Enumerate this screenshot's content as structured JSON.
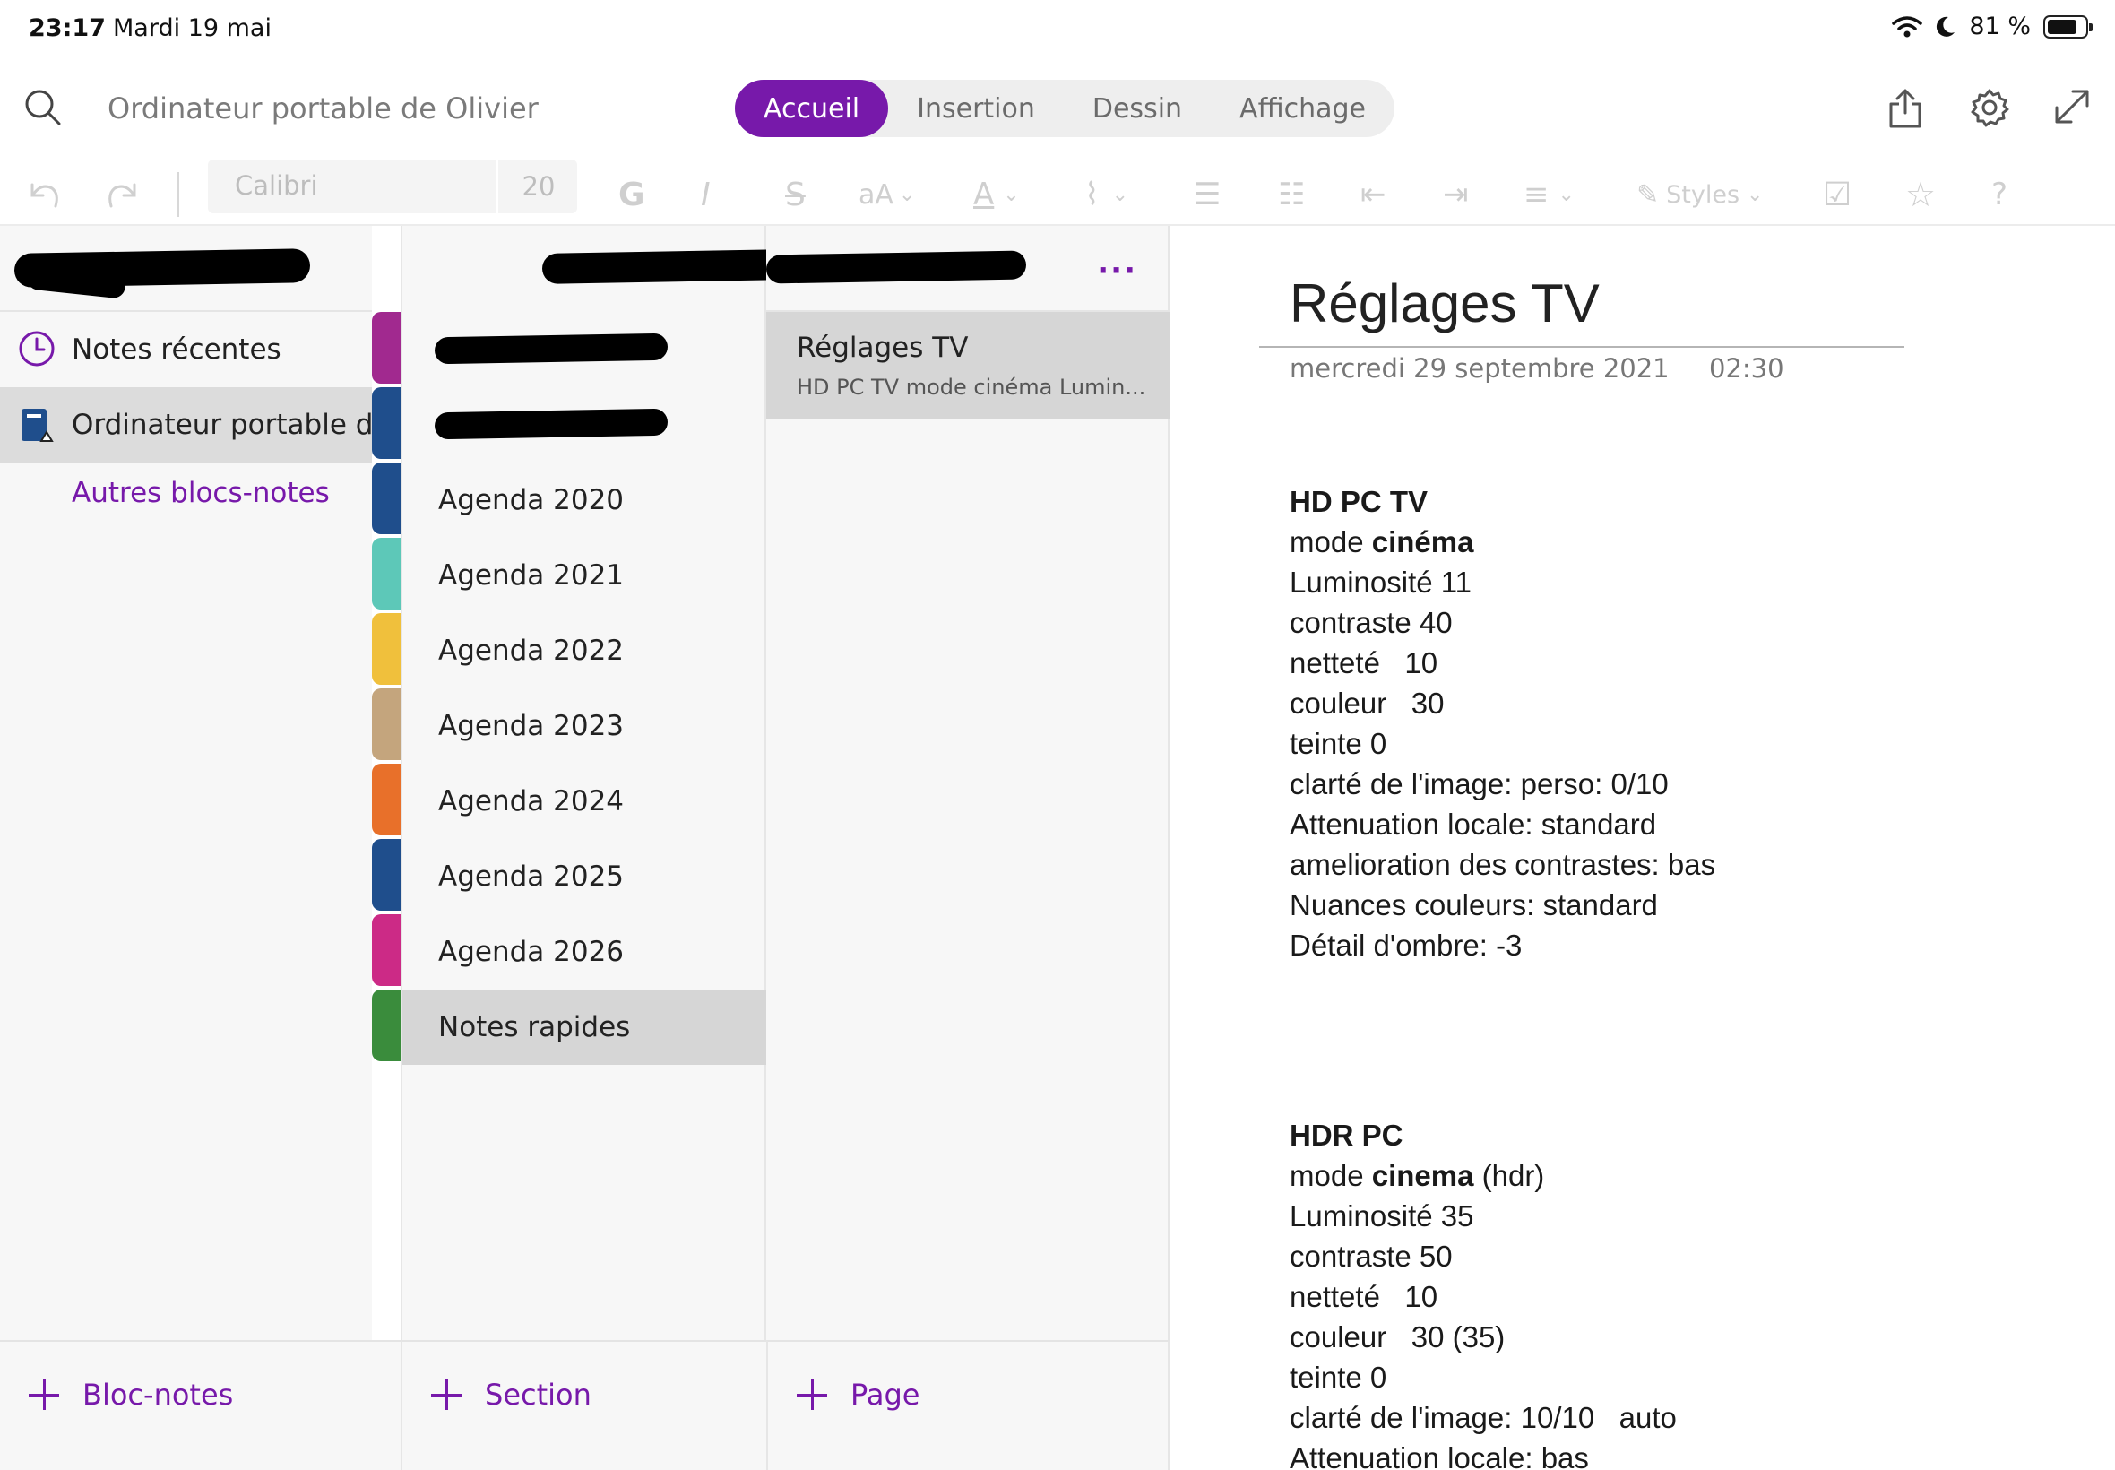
{
  "status_bar": {
    "time": "23:17",
    "date": "Mardi 19 mai",
    "battery": "81 %",
    "battery_level_percent": 81
  },
  "header": {
    "notebook_title": "Ordinateur portable de Olivier",
    "tabs": [
      {
        "label": "Accueil",
        "active": true
      },
      {
        "label": "Insertion",
        "active": false
      },
      {
        "label": "Dessin",
        "active": false
      },
      {
        "label": "Affichage",
        "active": false
      }
    ],
    "icons": [
      "share-icon",
      "gear-icon",
      "expand-icon"
    ]
  },
  "ribbon": {
    "font_name": "Calibri",
    "font_size": "20",
    "bold_label": "G",
    "italic_label": "I",
    "strike_label": "S",
    "case_label": "aA",
    "styles_label": "Styles"
  },
  "sidebar": {
    "recent": "Notes récentes",
    "current_notebook": "Ordinateur portable de...",
    "other": "Autres blocs-notes",
    "add_label": "Bloc-notes"
  },
  "sections": {
    "items": [
      {
        "label": "",
        "color": "#a1298f",
        "selected": false
      },
      {
        "label": "",
        "color": "#1f4e8c",
        "selected": false
      },
      {
        "label": "Agenda 2020",
        "color": "#1f4e8c",
        "selected": false
      },
      {
        "label": "Agenda 2021",
        "color": "#5dc8b8",
        "selected": false
      },
      {
        "label": "Agenda 2022",
        "color": "#f0c03c",
        "selected": false
      },
      {
        "label": "Agenda 2023",
        "color": "#c4a57d",
        "selected": false
      },
      {
        "label": "Agenda 2024",
        "color": "#e8702a",
        "selected": false
      },
      {
        "label": "Agenda 2025",
        "color": "#1f4e8c",
        "selected": false
      },
      {
        "label": "Agenda 2026",
        "color": "#cc2a86",
        "selected": false
      },
      {
        "label": "Notes rapides",
        "color": "#3a8c3c",
        "selected": true
      }
    ],
    "add_label": "Section"
  },
  "pages": {
    "items": [
      {
        "title": "Réglages TV",
        "preview": "HD PC TV  mode cinéma  Lumin..."
      }
    ],
    "add_label": "Page"
  },
  "note": {
    "title": "Réglages TV",
    "date": "mercredi 29 septembre 2021",
    "time": "02:30",
    "block1": [
      {
        "t": "HD PC TV",
        "bold": true
      },
      {
        "t": "mode ",
        "b": "cinéma"
      },
      {
        "t": "Luminosité 11"
      },
      {
        "t": "contraste 40"
      },
      {
        "t": "netteté   10"
      },
      {
        "t": "couleur   30"
      },
      {
        "t": "teinte 0"
      },
      {
        "t": "clarté de l'image: perso: 0/10"
      },
      {
        "t": "Attenuation locale: standard"
      },
      {
        "t": "amelioration des contrastes: bas"
      },
      {
        "t": "Nuances couleurs: standard"
      },
      {
        "t": "Détail d'ombre: -3"
      }
    ],
    "block2": [
      {
        "t": "HDR PC",
        "bold": true
      },
      {
        "t": "mode ",
        "b": "cinema",
        "after": " (hdr)"
      },
      {
        "t": "Luminosité 35"
      },
      {
        "t": "contraste 50"
      },
      {
        "t": "netteté   10"
      },
      {
        "t": "couleur   30 (35)"
      },
      {
        "t": "teinte 0"
      },
      {
        "t": "clarté de l'image: 10/10   auto"
      },
      {
        "t": "Attenuation locale: bas"
      }
    ]
  },
  "colors": {
    "accent": "#7719aa"
  }
}
